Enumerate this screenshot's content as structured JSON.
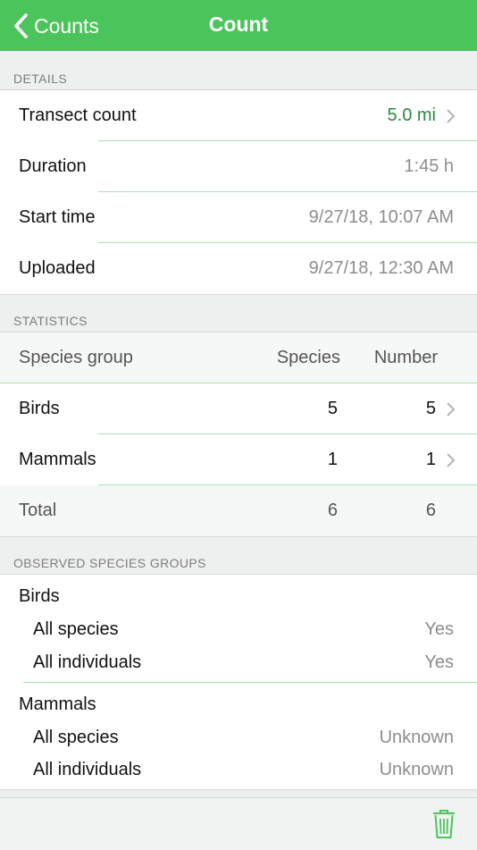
{
  "nav": {
    "back_label": "Counts",
    "title": "Count"
  },
  "details": {
    "header": "DETAILS",
    "rows": [
      {
        "label": "Transect count",
        "value": "5.0 mi"
      },
      {
        "label": "Duration",
        "value": "1:45 h"
      },
      {
        "label": "Start time",
        "value": "9/27/18, 10:07 AM"
      },
      {
        "label": "Uploaded",
        "value": "9/27/18, 12:30 AM"
      }
    ]
  },
  "statistics": {
    "header": "STATISTICS",
    "columns": [
      "Species group",
      "Species",
      "Number"
    ],
    "rows": [
      {
        "group": "Birds",
        "species": "5",
        "number": "5"
      },
      {
        "group": "Mammals",
        "species": "1",
        "number": "1"
      }
    ],
    "total": {
      "label": "Total",
      "species": "6",
      "number": "6"
    }
  },
  "observed": {
    "header": "OBSERVED SPECIES GROUPS",
    "groups": [
      {
        "name": "Birds",
        "items": [
          {
            "label": "All species",
            "value": "Yes"
          },
          {
            "label": "All individuals",
            "value": "Yes"
          }
        ]
      },
      {
        "name": "Mammals",
        "items": [
          {
            "label": "All species",
            "value": "Unknown"
          },
          {
            "label": "All individuals",
            "value": "Unknown"
          }
        ]
      }
    ]
  },
  "colors": {
    "accent": "#4cc45c",
    "link_value": "#2b8a3e",
    "divider": "#a9e2b1"
  },
  "icons": {
    "back": "chevron-left-icon",
    "disclosure": "chevron-right-icon",
    "delete": "trash-icon"
  }
}
